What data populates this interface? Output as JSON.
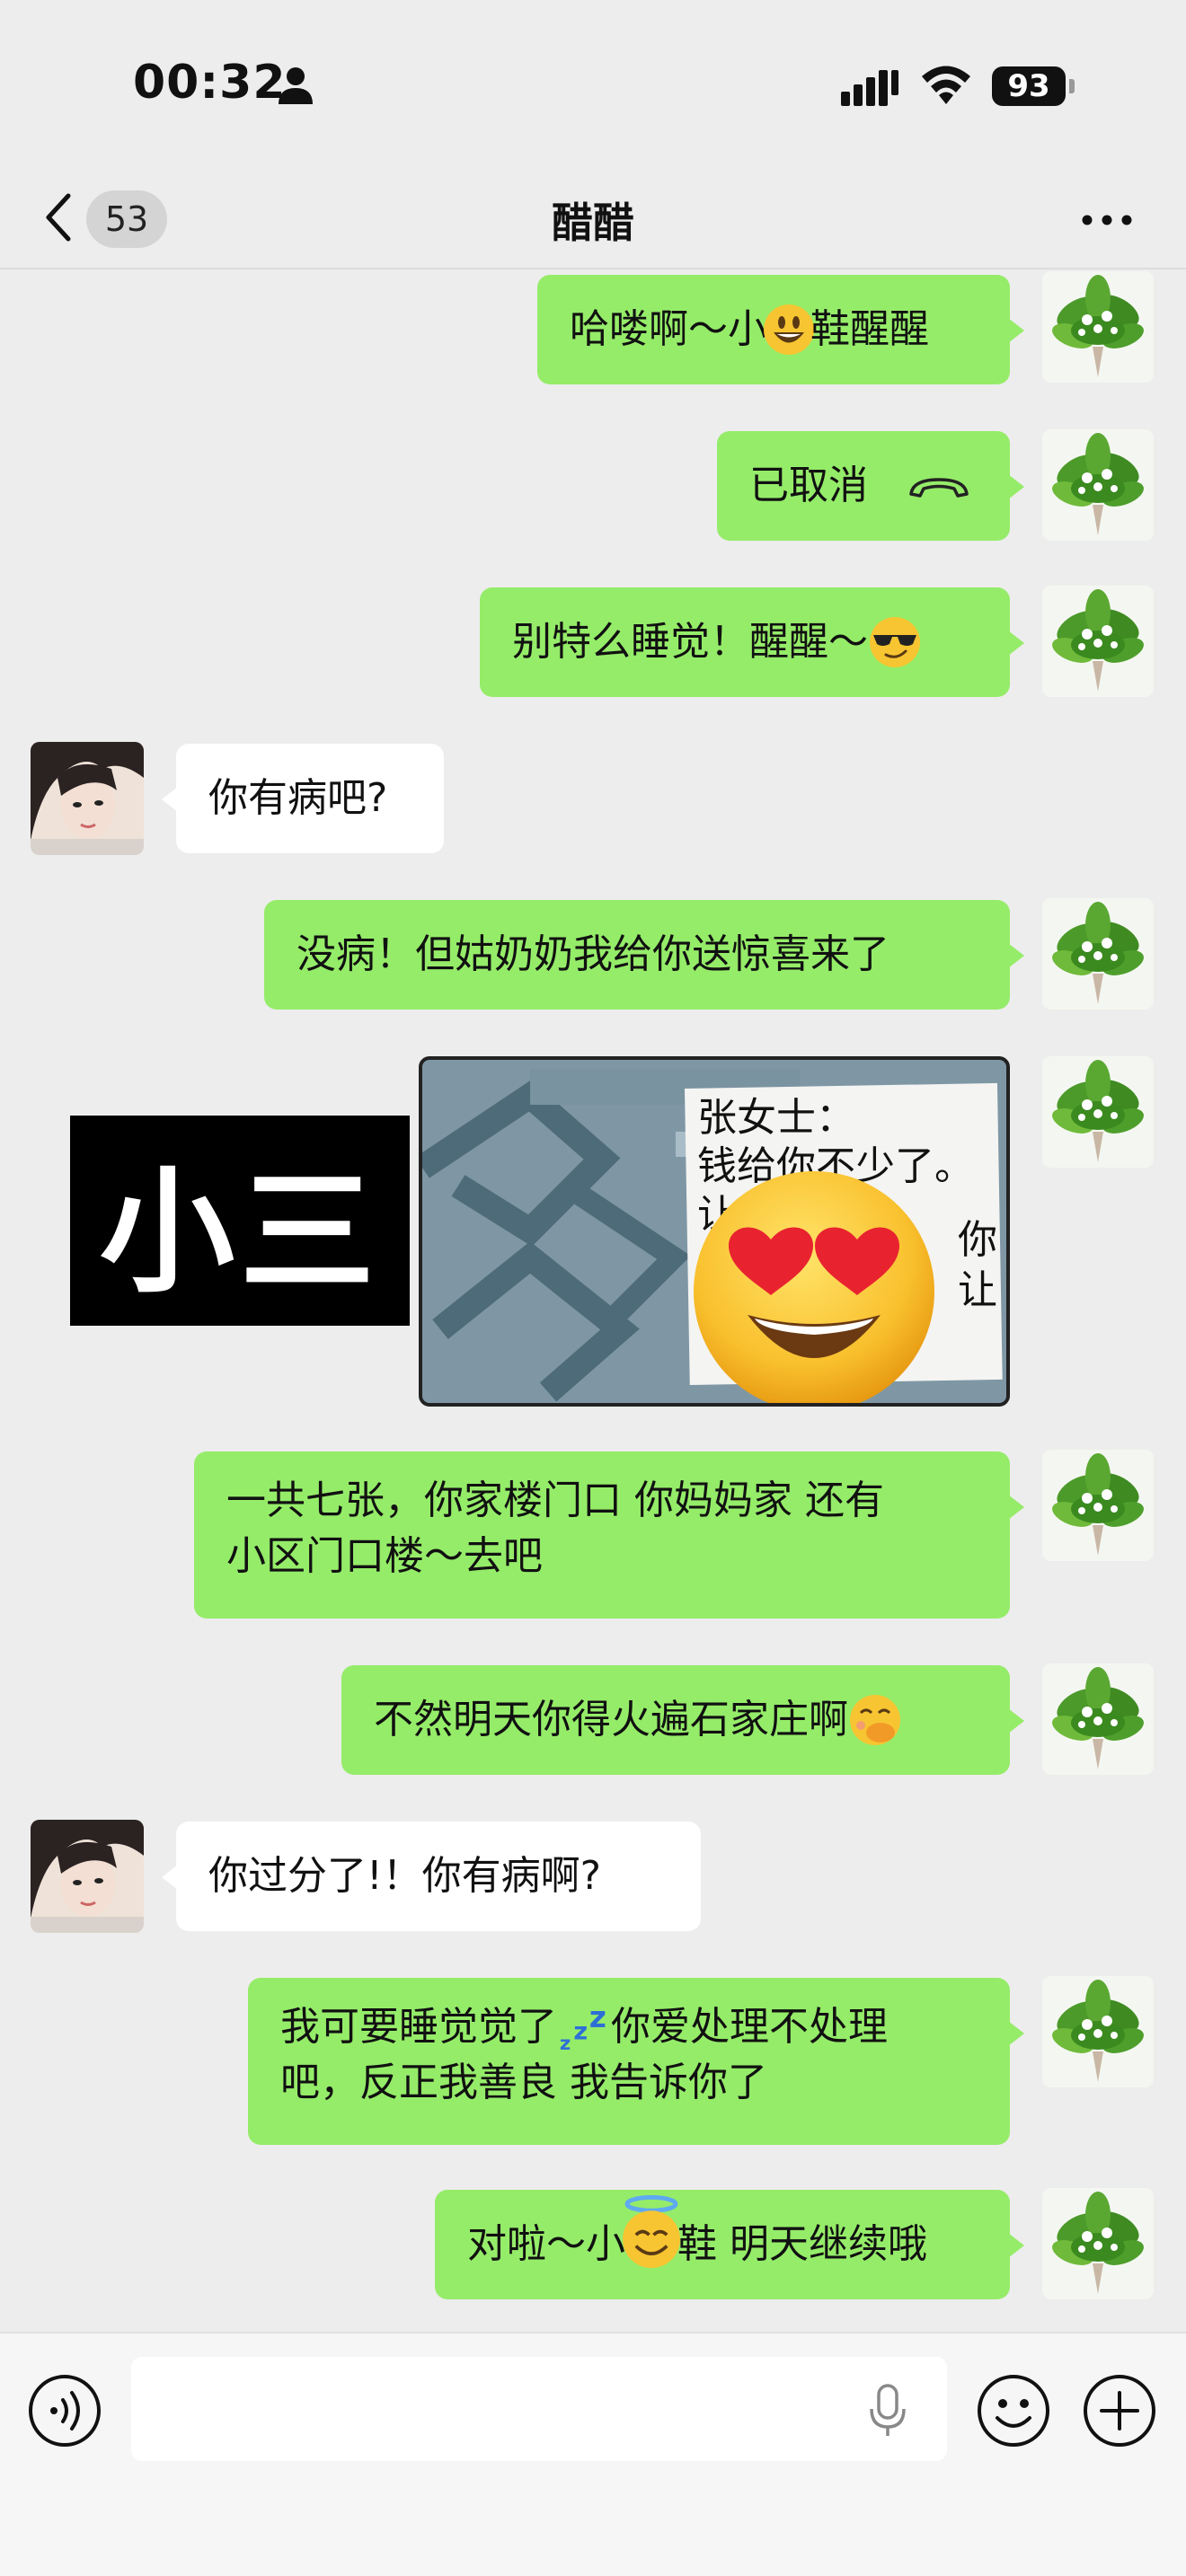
{
  "status_bar": {
    "time": "00:32",
    "battery": "93"
  },
  "nav": {
    "unread_count": "53",
    "title": "醋醋"
  },
  "messages": [
    {
      "from": "me",
      "text": "哈喽啊～小",
      "text_after": "鞋醒醒",
      "emoji": "grinning-emoji"
    },
    {
      "from": "me",
      "text": "已取消",
      "icon": "phone-hangup-icon"
    },
    {
      "from": "me",
      "text": "别特么睡觉！醒醒～",
      "emoji": "sunglasses-emoji"
    },
    {
      "from": "them",
      "text": "你有病吧?"
    },
    {
      "from": "me",
      "text": "没病！但姑奶奶我给你送惊喜来了"
    },
    {
      "from": "me",
      "type": "image",
      "redact_label": "小三",
      "note_lines": [
        "张女士：",
        "钱给你不少了。",
        "让",
        "你",
        "让"
      ],
      "emoji": "heart-eyes-emoji"
    },
    {
      "from": "me",
      "lines": [
        "一共七张，你家楼门口 你妈妈家 还有",
        "小区门口楼～去吧"
      ]
    },
    {
      "from": "me",
      "text": "不然明天你得火遍石家庄啊",
      "emoji": "face-hand-over-mouth-emoji"
    },
    {
      "from": "them",
      "text": "你过分了!！你有病啊?"
    },
    {
      "from": "me",
      "lines_a": "我可要睡觉觉了",
      "lines_b": "你爱处理不处理",
      "line2": "吧，反正我善良 我告诉你了",
      "emoji": "zzz-emoji"
    },
    {
      "from": "me",
      "text": "对啦～小",
      "text_after": "鞋 明天继续哦",
      "emoji": "halo-emoji"
    }
  ],
  "colors": {
    "my_bubble": "#95ec69",
    "their_bubble": "#ffffff",
    "background": "#ededed"
  }
}
